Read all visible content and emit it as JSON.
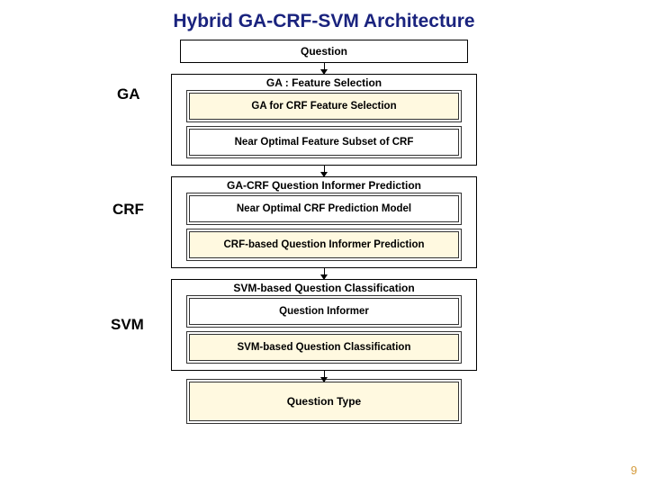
{
  "title": "Hybrid GA-CRF-SVM Architecture",
  "page_number": "9",
  "input_box": "Question",
  "stages": {
    "ga": {
      "label": "GA",
      "header": "GA : Feature Selection",
      "box1": "GA for CRF Feature Selection",
      "box2": "Near Optimal Feature Subset of CRF"
    },
    "crf": {
      "label": "CRF",
      "header": "GA-CRF Question Informer Prediction",
      "box1": "Near Optimal CRF Prediction Model",
      "box2": "CRF-based Question Informer Prediction"
    },
    "svm": {
      "label": "SVM",
      "header": "SVM-based Question Classification",
      "box1": "Question Informer",
      "box2": "SVM-based Question Classification"
    }
  },
  "output_box": "Question Type"
}
